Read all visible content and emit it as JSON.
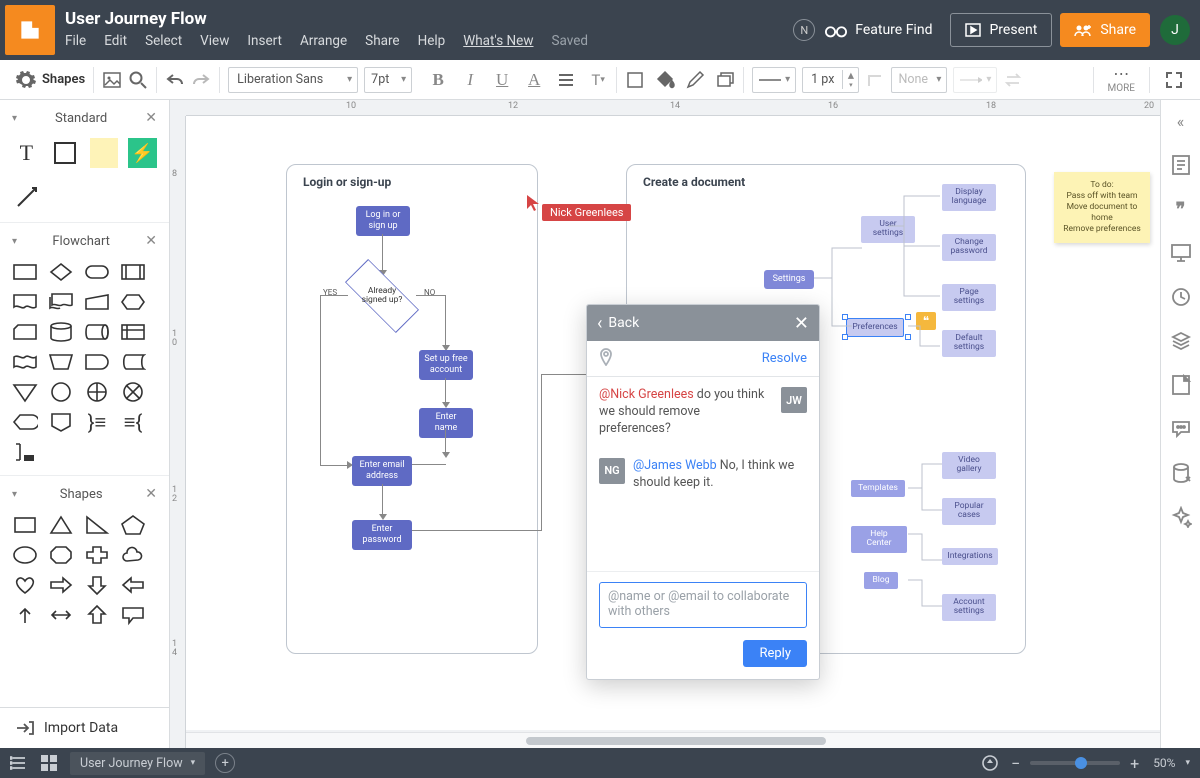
{
  "header": {
    "title": "User Journey Flow",
    "menus": [
      "File",
      "Edit",
      "Select",
      "View",
      "Insert",
      "Arrange",
      "Share",
      "Help"
    ],
    "whats_new": "What's New",
    "saved": "Saved",
    "badge": "N",
    "feature_find": "Feature Find",
    "present": "Present",
    "share": "Share",
    "avatar": "J"
  },
  "toolbar": {
    "shapes": "Shapes",
    "font": "Liberation Sans",
    "font_size": "7pt",
    "line_width": "1 px",
    "fill": "None",
    "more": "MORE"
  },
  "left_panel": {
    "standard": "Standard",
    "flowchart": "Flowchart",
    "shapes": "Shapes",
    "import": "Import Data"
  },
  "ruler_h": {
    "10": "10",
    "12": "12",
    "14": "14",
    "16": "16",
    "18": "18",
    "20": "20"
  },
  "ruler_v": {
    "8": "8",
    "10": "1\n0",
    "12": "1\n2",
    "14": "1\n4"
  },
  "group1": {
    "title": "Login or sign-up",
    "login": "Log in or\nsign up",
    "already": "Already\nsigned up?",
    "yes": "YES",
    "no": "NO",
    "setup": "Set up free\naccount",
    "name": "Enter name",
    "email": "Enter email\naddress",
    "password": "Enter\npassword"
  },
  "group2": {
    "title": "Create a document",
    "settings": "Settings",
    "user_settings": "User\nsettings",
    "preferences": "Preferences",
    "display_lang": "Display\nlanguage",
    "change_pw": "Change\npassword",
    "page_settings": "Page\nsettings",
    "default_settings": "Default\nsettings",
    "templates": "Templates",
    "help_center": "Help Center",
    "blog": "Blog",
    "video_gallery": "Video\ngallery",
    "popular_cases": "Popular\ncases",
    "integrations": "Integrations",
    "account_settings": "Account\nsettings"
  },
  "sticky": "To do:\nPass off with team\nMove document to home\nRemove preferences",
  "remote_cursor": "Nick Greenlees",
  "comments": {
    "back": "Back",
    "resolve": "Resolve",
    "c1_mention": "@Nick Greenlees",
    "c1_text": " do you think we should remove preferences?",
    "c1_av": "JW",
    "c2_mention": "@James Webb",
    "c2_text": " No, I think we should keep it.",
    "c2_av": "NG",
    "placeholder": "@name or @email to collaborate with others",
    "reply": "Reply"
  },
  "bottom": {
    "page": "User Journey Flow",
    "zoom": "50%"
  }
}
